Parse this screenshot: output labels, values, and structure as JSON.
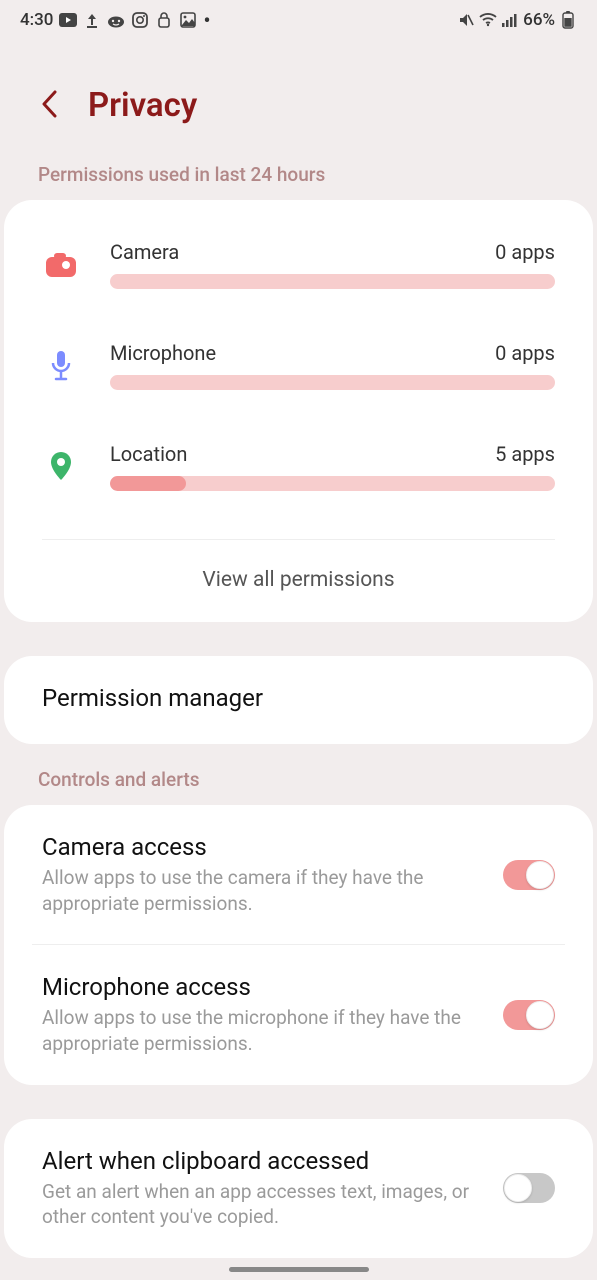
{
  "status": {
    "time": "4:30",
    "battery": "66%"
  },
  "header": {
    "title": "Privacy"
  },
  "sectionA": {
    "label": "Permissions used in last 24 hours",
    "items": [
      {
        "name": "Camera",
        "count": "0 apps",
        "fill": 0
      },
      {
        "name": "Microphone",
        "count": "0 apps",
        "fill": 0
      },
      {
        "name": "Location",
        "count": "5 apps",
        "fill": 17
      }
    ],
    "viewAll": "View all permissions"
  },
  "permManager": {
    "title": "Permission manager"
  },
  "sectionB": {
    "label": "Controls and alerts",
    "items": [
      {
        "title": "Camera access",
        "sub": "Allow apps to use the camera if they have the appropriate permissions.",
        "on": true
      },
      {
        "title": "Microphone access",
        "sub": "Allow apps to use the microphone if they have the appropriate permissions.",
        "on": true
      },
      {
        "title": "Alert when clipboard accessed",
        "sub": "Get an alert when an app accesses text, images, or other content you've copied.",
        "on": false
      }
    ]
  }
}
